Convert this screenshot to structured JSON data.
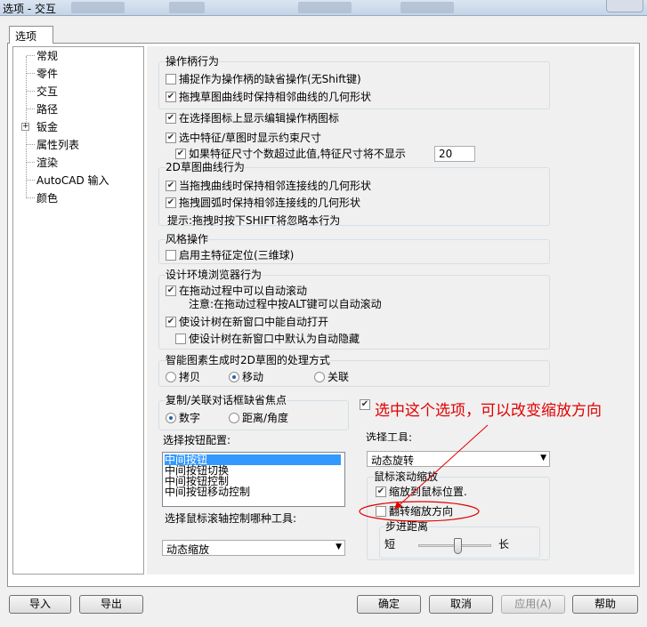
{
  "window": {
    "title": "选项 - 交互"
  },
  "tabs": [
    {
      "label": "选项"
    }
  ],
  "tree": {
    "items": [
      {
        "label": "常规"
      },
      {
        "label": "零件"
      },
      {
        "label": "交互"
      },
      {
        "label": "路径"
      },
      {
        "label": "钣金"
      },
      {
        "label": "属性列表"
      },
      {
        "label": "渲染"
      },
      {
        "label": "AutoCAD 输入"
      },
      {
        "label": "颜色"
      }
    ],
    "expander": "+"
  },
  "handle_behavior": {
    "title": "操作柄行为",
    "capture_default": {
      "label": "捕捉作为操作柄的缺省操作(无Shift键)",
      "checked": false
    },
    "keep_geometry": {
      "label": "拖拽草图曲线时保持相邻曲线的几何形状",
      "checked": true
    }
  },
  "show_handle_icon": {
    "label": "在选择图标上显示编辑操作柄图标",
    "checked": true
  },
  "show_constraint_dims": {
    "label": "选中特征/草图时显示约束尺寸",
    "checked": true
  },
  "hide_dims_if_exceed": {
    "label": "如果特征尺寸个数超过此值,特征尺寸将不显示",
    "checked": true,
    "value": "20"
  },
  "sketch2d": {
    "title": "2D草图曲线行为",
    "keep_connected": {
      "label": "当拖拽曲线时保持相邻连接线的几何形状",
      "checked": true
    },
    "keep_arc_connected": {
      "label": "拖拽圆弧时保持相邻连接线的几何形状",
      "checked": true
    },
    "hint": "提示:拖拽时按下SHIFT将忽略本行为"
  },
  "style_ops": {
    "title": "风格操作",
    "enable_positioning": {
      "label": "启用主特征定位(三维球)",
      "checked": false
    }
  },
  "browser_behavior": {
    "title": "设计环境浏览器行为",
    "auto_scroll": {
      "label": "在拖动过程中可以自动滚动",
      "checked": true
    },
    "note": "注意:在拖动过程中按ALT键可以自动滚动",
    "auto_open": {
      "label": "使设计树在新窗口中能自动打开",
      "checked": true
    },
    "auto_hide": {
      "label": "使设计树在新窗口中默认为自动隐藏",
      "checked": false
    }
  },
  "smart_2d": {
    "title": "智能图素生成时2D草图的处理方式",
    "options": [
      {
        "label": "拷贝"
      },
      {
        "label": "移动"
      },
      {
        "label": "关联"
      }
    ],
    "selected": "移动"
  },
  "copy_focus": {
    "title": "复制/关联对话框缺省焦点",
    "options": [
      {
        "label": "数字"
      },
      {
        "label": "距离/角度"
      }
    ],
    "selected": "数字"
  },
  "button_config": {
    "title": "选择按钮配置:",
    "items": [
      {
        "label": "中间按钮"
      },
      {
        "label": "中间按钮切换"
      },
      {
        "label": "中间按钮控制"
      },
      {
        "label": "中间按钮移动控制"
      }
    ],
    "selected": "中间按钮"
  },
  "wheel_tool": {
    "label": "选择鼠标滚轴控制哪种工具:",
    "value": "动态缩放"
  },
  "select_tool": {
    "label": "选择工具:",
    "value": "动态旋转"
  },
  "wheel_zoom": {
    "title": "鼠标滚动缩放",
    "zoom_to_cursor": {
      "label": "缩放到鼠标位置.",
      "checked": true
    },
    "reverse_zoom": {
      "label": "翻转缩放方向",
      "checked": false
    },
    "step": {
      "title": "步进距离",
      "short": "短",
      "long": "长",
      "level": 0.55
    }
  },
  "annotation": {
    "text": "选中这个选项，可以改变缩放方向",
    "color": "#e00000"
  },
  "extra_checkbox": {
    "checked": true
  },
  "buttons": {
    "import": "导入",
    "export": "导出",
    "ok": "确定",
    "cancel": "取消",
    "apply": "应用(A)",
    "help": "帮助"
  },
  "colors": {
    "selection": "#3399ff",
    "annotation": "#e00000"
  }
}
